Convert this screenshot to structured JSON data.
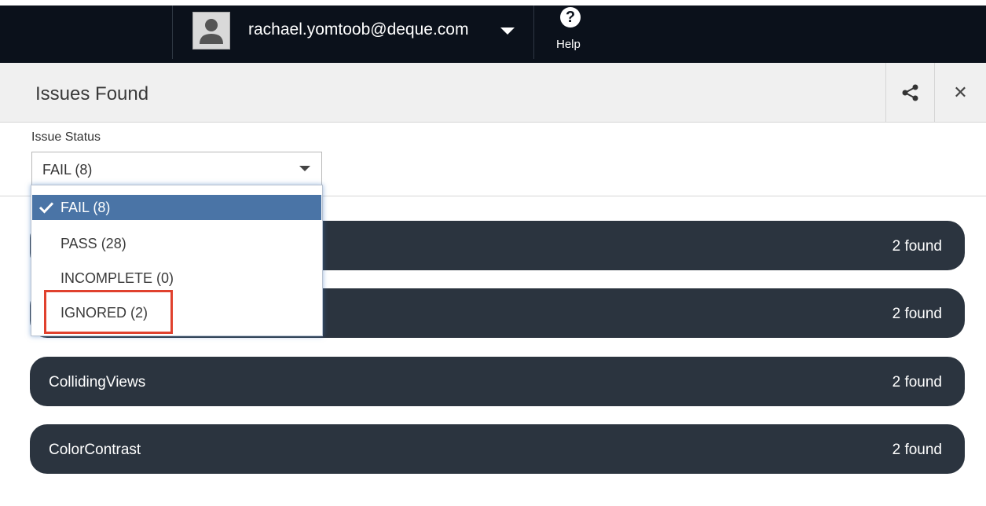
{
  "topbar": {
    "user_email": "rachael.yomtoob@deque.com",
    "help_label": "Help",
    "icons": [
      "user-avatar-icon",
      "chevron-down-icon",
      "help-circle-icon"
    ]
  },
  "header": {
    "title": "Issues Found",
    "icons": [
      "share-icon",
      "close-icon"
    ]
  },
  "filter": {
    "label": "Issue Status",
    "selected": "FAIL (8)",
    "options": [
      {
        "label": "FAIL (8)",
        "selected": true
      },
      {
        "label": "PASS (28)",
        "selected": false
      },
      {
        "label": "INCOMPLETE (0)",
        "selected": false
      },
      {
        "label": "IGNORED (2)",
        "selected": false,
        "highlighted": true
      }
    ]
  },
  "issues": [
    {
      "name": "",
      "count": "2 found"
    },
    {
      "name": "",
      "count": "2 found"
    },
    {
      "name": "CollidingViews",
      "count": "2 found"
    },
    {
      "name": "ColorContrast",
      "count": "2 found"
    }
  ],
  "colors": {
    "topbar_bg": "#0b111b",
    "issue_bar_bg": "#2b343f",
    "selected_option_bg": "#4a74a6",
    "highlight_border": "#e0412e"
  }
}
